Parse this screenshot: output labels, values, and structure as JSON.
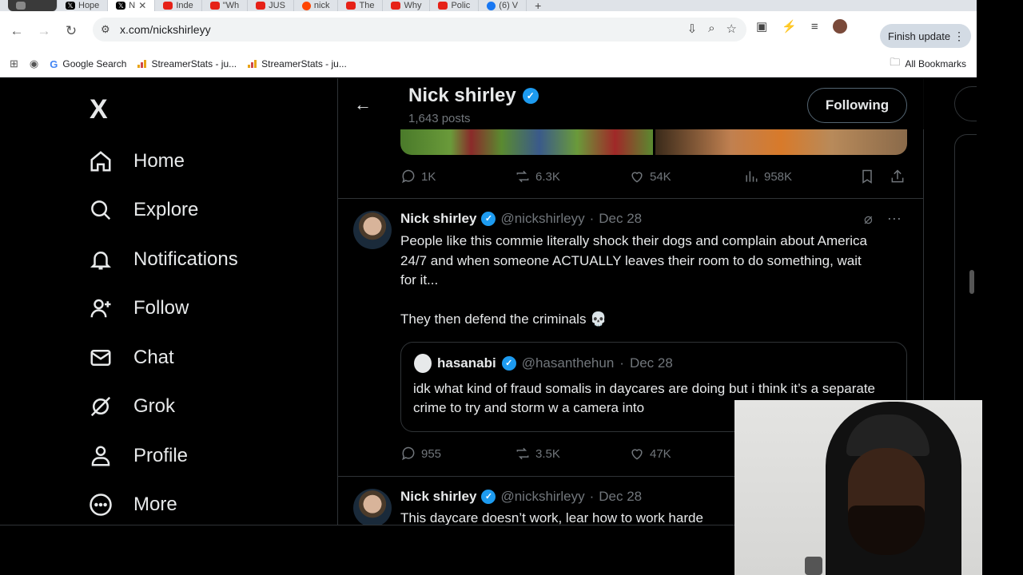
{
  "browser": {
    "tabs": [
      {
        "label": "",
        "icon": "screen-icon"
      },
      {
        "label": "Hope",
        "icon": "x-icon"
      },
      {
        "label": "N",
        "icon": "x-icon",
        "active": true
      },
      {
        "label": "Inde",
        "icon": "youtube-icon"
      },
      {
        "label": "\"Wh",
        "icon": "youtube-icon"
      },
      {
        "label": "JUS",
        "icon": "youtube-icon"
      },
      {
        "label": "nick",
        "icon": "reddit-icon"
      },
      {
        "label": "The",
        "icon": "youtube-icon"
      },
      {
        "label": "Why",
        "icon": "youtube-icon"
      },
      {
        "label": "Polic",
        "icon": "youtube-icon"
      },
      {
        "label": "(6) V",
        "icon": "facebook-icon"
      }
    ],
    "url": "x.com/nickshirleyy",
    "finish_update": "Finish update",
    "bookmarks": [
      {
        "label": "",
        "icon": "globe-icon"
      },
      {
        "label": "Google Search",
        "icon": "google-icon"
      },
      {
        "label": "StreamerStats - ju...",
        "icon": "bars-icon"
      },
      {
        "label": "StreamerStats - ju...",
        "icon": "bars-icon"
      }
    ],
    "all_bookmarks": "All Bookmarks"
  },
  "nav": {
    "logo": "X",
    "items": [
      {
        "label": "Home",
        "icon": "home-icon"
      },
      {
        "label": "Explore",
        "icon": "search-icon"
      },
      {
        "label": "Notifications",
        "icon": "bell-icon"
      },
      {
        "label": "Follow",
        "icon": "follow-icon"
      },
      {
        "label": "Chat",
        "icon": "mail-icon"
      },
      {
        "label": "Grok",
        "icon": "grok-icon"
      },
      {
        "label": "Profile",
        "icon": "person-icon"
      },
      {
        "label": "More",
        "icon": "more-icon"
      }
    ]
  },
  "header": {
    "name": "Nick shirley",
    "posts": "1,643 posts",
    "following": "Following"
  },
  "prev_post": {
    "replies": "1K",
    "reposts": "6.3K",
    "likes": "54K",
    "views": "958K"
  },
  "post1": {
    "name": "Nick shirley",
    "handle": "@nickshirleyy",
    "date": "Dec 28",
    "text": "People like this commie literally shock their dogs and complain about America 24/7 and when someone ACTUALLY leaves their room to do something, wait for it...\n\nThey then defend the criminals 💀",
    "quote": {
      "name": "hasanabi",
      "handle": "@hasanthehun",
      "date": "Dec 28",
      "text": "idk what kind of fraud somalis in daycares are doing but i think it’s a separate crime to try and storm w a camera into"
    },
    "replies": "955",
    "reposts": "3.5K",
    "likes": "47K"
  },
  "post2": {
    "name": "Nick shirley",
    "handle": "@nickshirleyy",
    "date": "Dec 28",
    "text": "This daycare doesn’t work, lear how to work harde"
  },
  "sep": "·",
  "colors": {
    "verified": "#1d9bf0",
    "text": "#e7e9ea",
    "muted": "#71767b",
    "border": "#2f3336"
  }
}
